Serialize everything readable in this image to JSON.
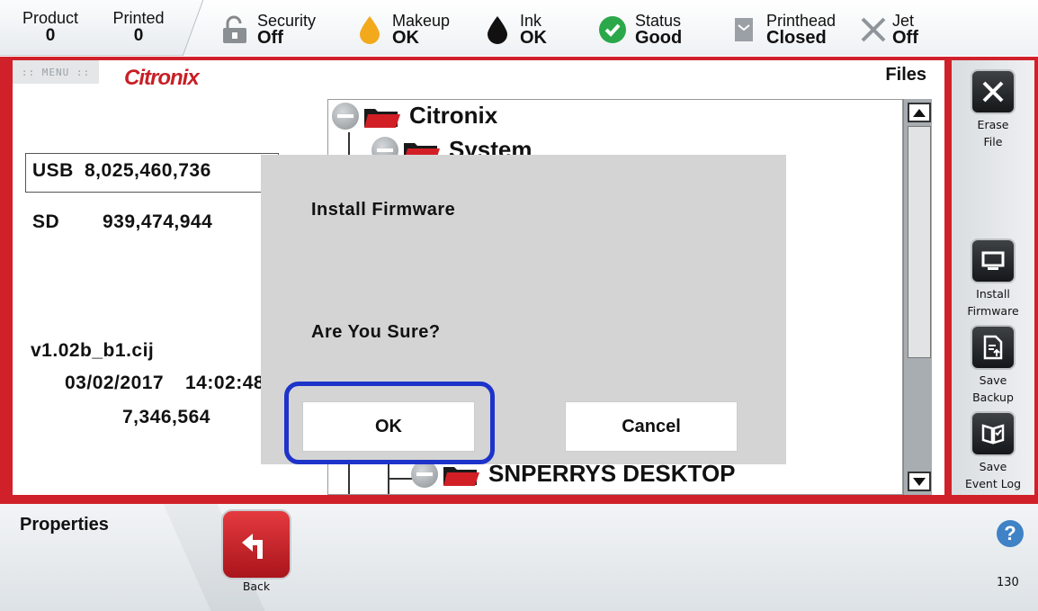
{
  "status_bar": {
    "product": {
      "label": "Product",
      "value": "0"
    },
    "printed": {
      "label": "Printed",
      "value": "0"
    },
    "security": {
      "label": "Security",
      "value": "Off"
    },
    "makeup": {
      "label": "Makeup",
      "value": "OK"
    },
    "ink": {
      "label": "Ink",
      "value": "OK"
    },
    "status": {
      "label": "Status",
      "value": "Good"
    },
    "printhead": {
      "label": "Printhead",
      "value": "Closed"
    },
    "jet": {
      "label": "Jet",
      "value": "Off"
    }
  },
  "header": {
    "menu_label": ":: MENU ::",
    "logo_text": "Citronix",
    "files_title": "Files"
  },
  "storage": {
    "usb_label": "USB",
    "usb_value": "8,025,460,736",
    "sd_label": "SD",
    "sd_value": "939,474,944"
  },
  "file_info": {
    "name": "v1.02b_b1.cij",
    "date": "03/02/2017",
    "time": "14:02:48",
    "size": "7,346,564"
  },
  "tree": {
    "root": "Citronix",
    "child": "System",
    "bottom": "SNPERRYS DESKTOP"
  },
  "tools": {
    "erase_label_1": "Erase",
    "erase_label_2": "File",
    "install_label_1": "Install",
    "install_label_2": "Firmware",
    "backup_label_1": "Save",
    "backup_label_2": "Backup",
    "eventlog_label_1": "Save",
    "eventlog_label_2": "Event Log"
  },
  "dialog": {
    "title": "Install Firmware",
    "message": "Are You Sure?",
    "ok_label": "OK",
    "cancel_label": "Cancel"
  },
  "bottom": {
    "properties_label": "Properties",
    "back_label": "Back",
    "help_glyph": "?",
    "page_number": "130"
  },
  "colors": {
    "brand_red": "#d0212a",
    "highlight_blue": "#1d33c9",
    "help_blue": "#3f82c5"
  }
}
